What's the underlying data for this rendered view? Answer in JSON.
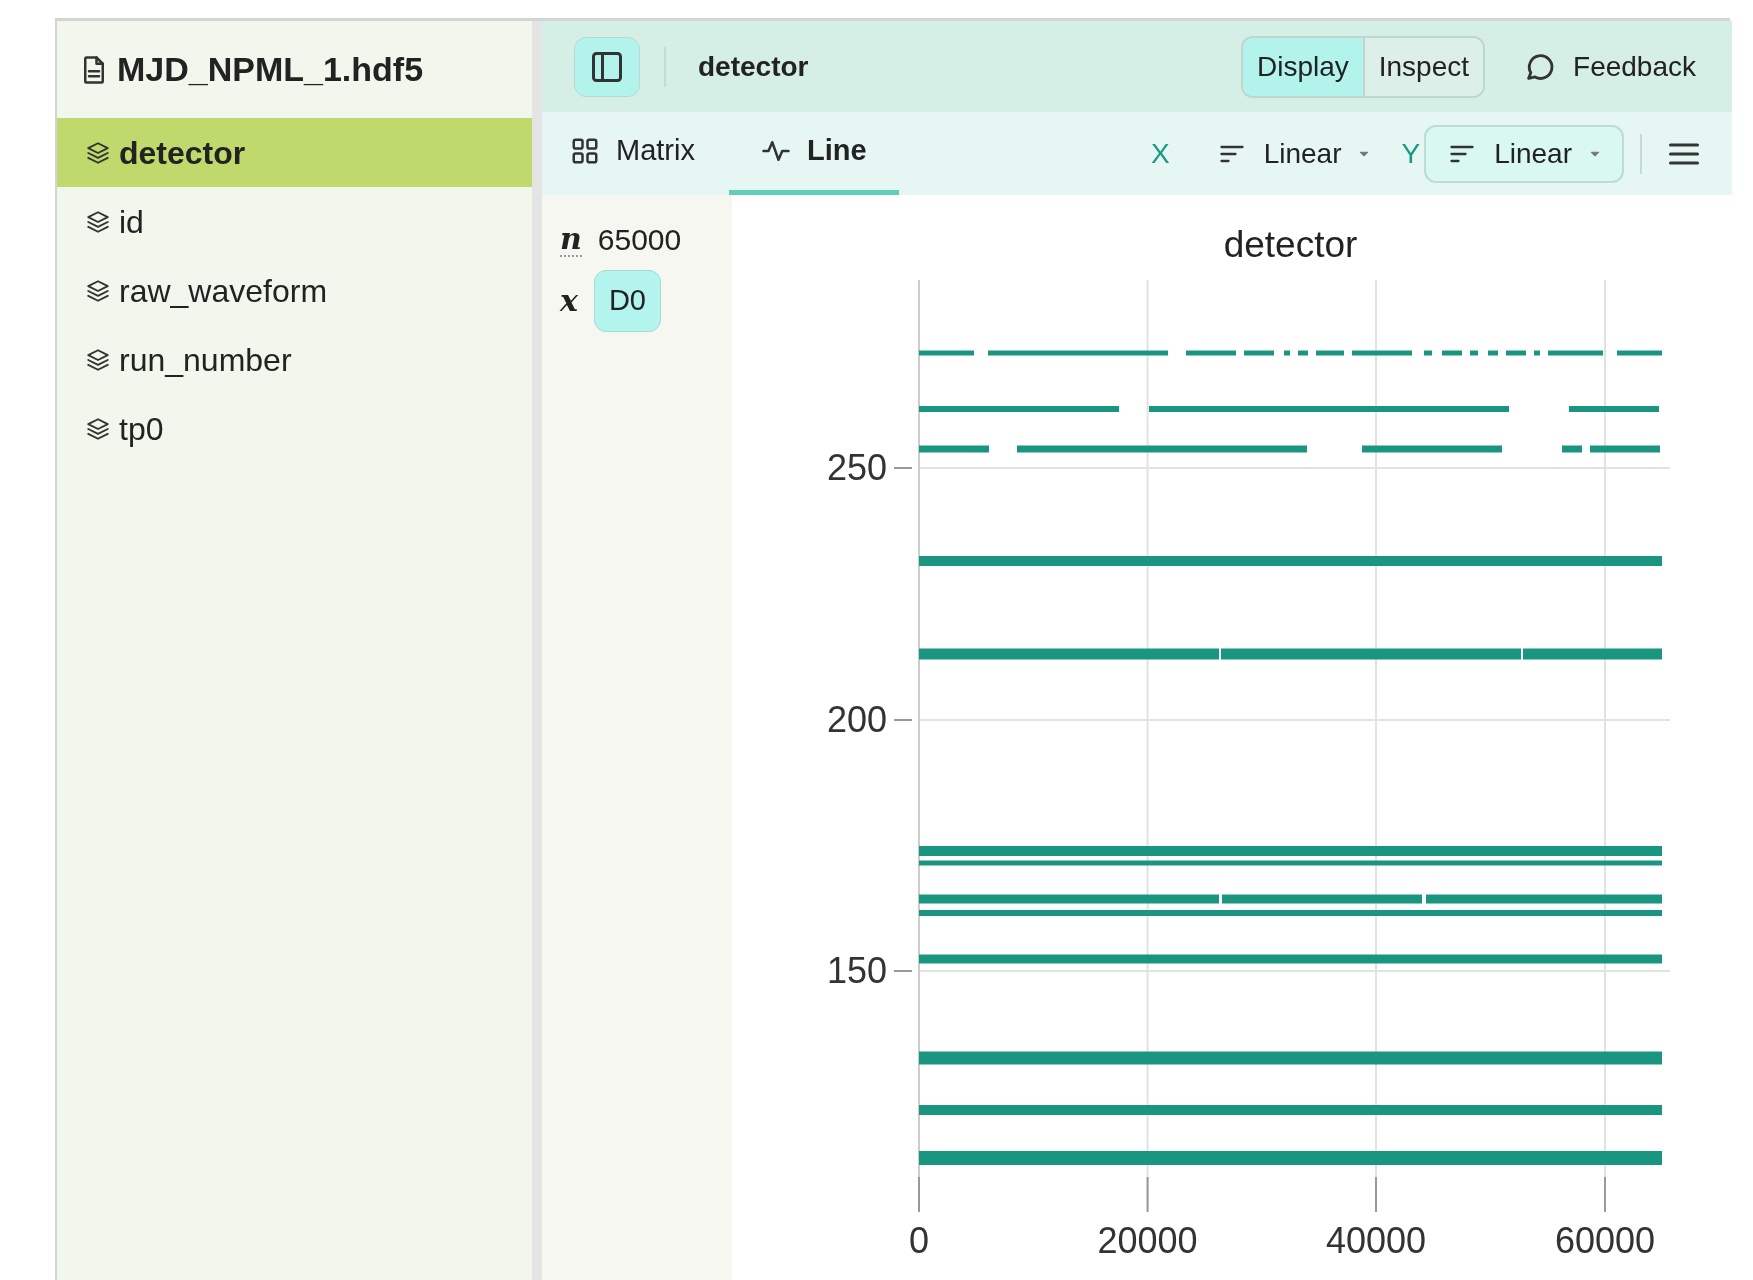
{
  "file": {
    "name": "MJD_NPML_1.hdf5"
  },
  "sidebar": {
    "items": [
      {
        "label": "detector",
        "selected": true
      },
      {
        "label": "id",
        "selected": false
      },
      {
        "label": "raw_waveform",
        "selected": false
      },
      {
        "label": "run_number",
        "selected": false
      },
      {
        "label": "tp0",
        "selected": false
      }
    ]
  },
  "header": {
    "sidebar_toggle": {
      "selected": true
    },
    "breadcrumb": "detector",
    "modes": [
      {
        "label": "Display",
        "selected": true
      },
      {
        "label": "Inspect",
        "selected": false
      }
    ],
    "feedback": "Feedback"
  },
  "toolbar": {
    "tabs": [
      {
        "label": "Matrix",
        "kind": "matrix",
        "selected": false
      },
      {
        "label": "Line",
        "kind": "line",
        "selected": true
      }
    ],
    "scales": [
      {
        "axis": "X",
        "value": "Linear",
        "hovered": false
      },
      {
        "axis": "Y",
        "value": "Linear",
        "hovered": true
      }
    ]
  },
  "dims": {
    "size_label": "n",
    "size": "65000",
    "axis_label": "x",
    "dims": [
      {
        "label": "D0",
        "selected": true
      }
    ]
  },
  "plot": {
    "title": "detector",
    "x_ticks": [
      "0",
      "20000",
      "40000",
      "60000"
    ],
    "y_ticks": [
      "250",
      "200",
      "150"
    ]
  }
}
